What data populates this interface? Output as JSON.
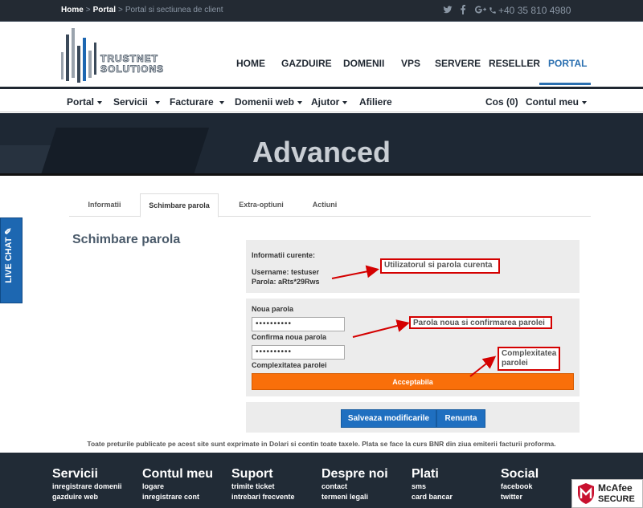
{
  "topbar": {
    "breadcrumb": [
      "Home",
      "Portal",
      "Portal si sectiunea de client"
    ],
    "separator": ">",
    "social_icons": [
      "twitter-icon",
      "facebook-icon",
      "google-plus-icon"
    ],
    "phone": "+40 35 810 4980",
    "phone_icon": "phone-icon"
  },
  "logo": {
    "line1": "TRUSTNET",
    "line2": "SOLUTIONS"
  },
  "main_nav": [
    "HOME",
    "GAZDUIRE",
    "DOMENII",
    "VPS",
    "SERVERE",
    "RESELLER",
    "PORTAL"
  ],
  "main_nav_active": "PORTAL",
  "sub_nav": {
    "left": [
      "Portal",
      "Servicii",
      "Facturare",
      "Domenii web",
      "Ajutor",
      "Afiliere"
    ],
    "cart": "Cos (0)",
    "account": "Contul meu"
  },
  "banner": {
    "title": "Advanced"
  },
  "live_chat": {
    "label": "LIVE CHAT",
    "icon": "chat-bubble-icon"
  },
  "tabs": [
    "Informatii",
    "Schimbare parola",
    "Extra-optiuni",
    "Actiuni"
  ],
  "active_tab": "Schimbare parola",
  "section_title": "Schimbare parola",
  "current_info": {
    "heading": "Informatii curente:",
    "username": "Username: testuser",
    "password": "Parola: aRts*29Rws"
  },
  "form": {
    "new_password_label": "Noua parola",
    "new_password_value": "••••••••••",
    "confirm_label": "Confirma noua parola",
    "confirm_value": "••••••••••",
    "complexity_label": "Complexitatea parolei",
    "complexity_value": "Acceptabila"
  },
  "buttons": {
    "save": "Salveaza modificarile",
    "cancel": "Renunta"
  },
  "callouts": {
    "current": "Utilizatorul si parola curenta",
    "new": "Parola noua si confirmarea parolei",
    "complexity": "Complexitatea parolei"
  },
  "colors": {
    "accent": "#1f6fc0",
    "complexity": "#f96f0a",
    "callout": "#d40000",
    "dark": "#212b36"
  },
  "disclaimer": "Toate preturile publicate pe acest site sunt exprimate in Dolari si contin toate taxele. Plata se face la curs BNR din ziua emiterii facturii proforma.",
  "footer": {
    "columns": [
      {
        "title": "Servicii",
        "links": [
          "inregistrare domenii",
          "gazduire web"
        ]
      },
      {
        "title": "Contul meu",
        "links": [
          "logare",
          "inregistrare cont"
        ]
      },
      {
        "title": "Suport",
        "links": [
          "trimite ticket",
          "intrebari frecvente"
        ]
      },
      {
        "title": "Despre noi",
        "links": [
          "contact",
          "termeni legali"
        ]
      },
      {
        "title": "Plati",
        "links": [
          "sms",
          "card bancar"
        ]
      },
      {
        "title": "Social",
        "links": [
          "facebook",
          "twitter"
        ]
      }
    ],
    "badge": {
      "name": "McAfee",
      "sub": "SECURE",
      "icon": "mcafee-shield-icon"
    }
  }
}
